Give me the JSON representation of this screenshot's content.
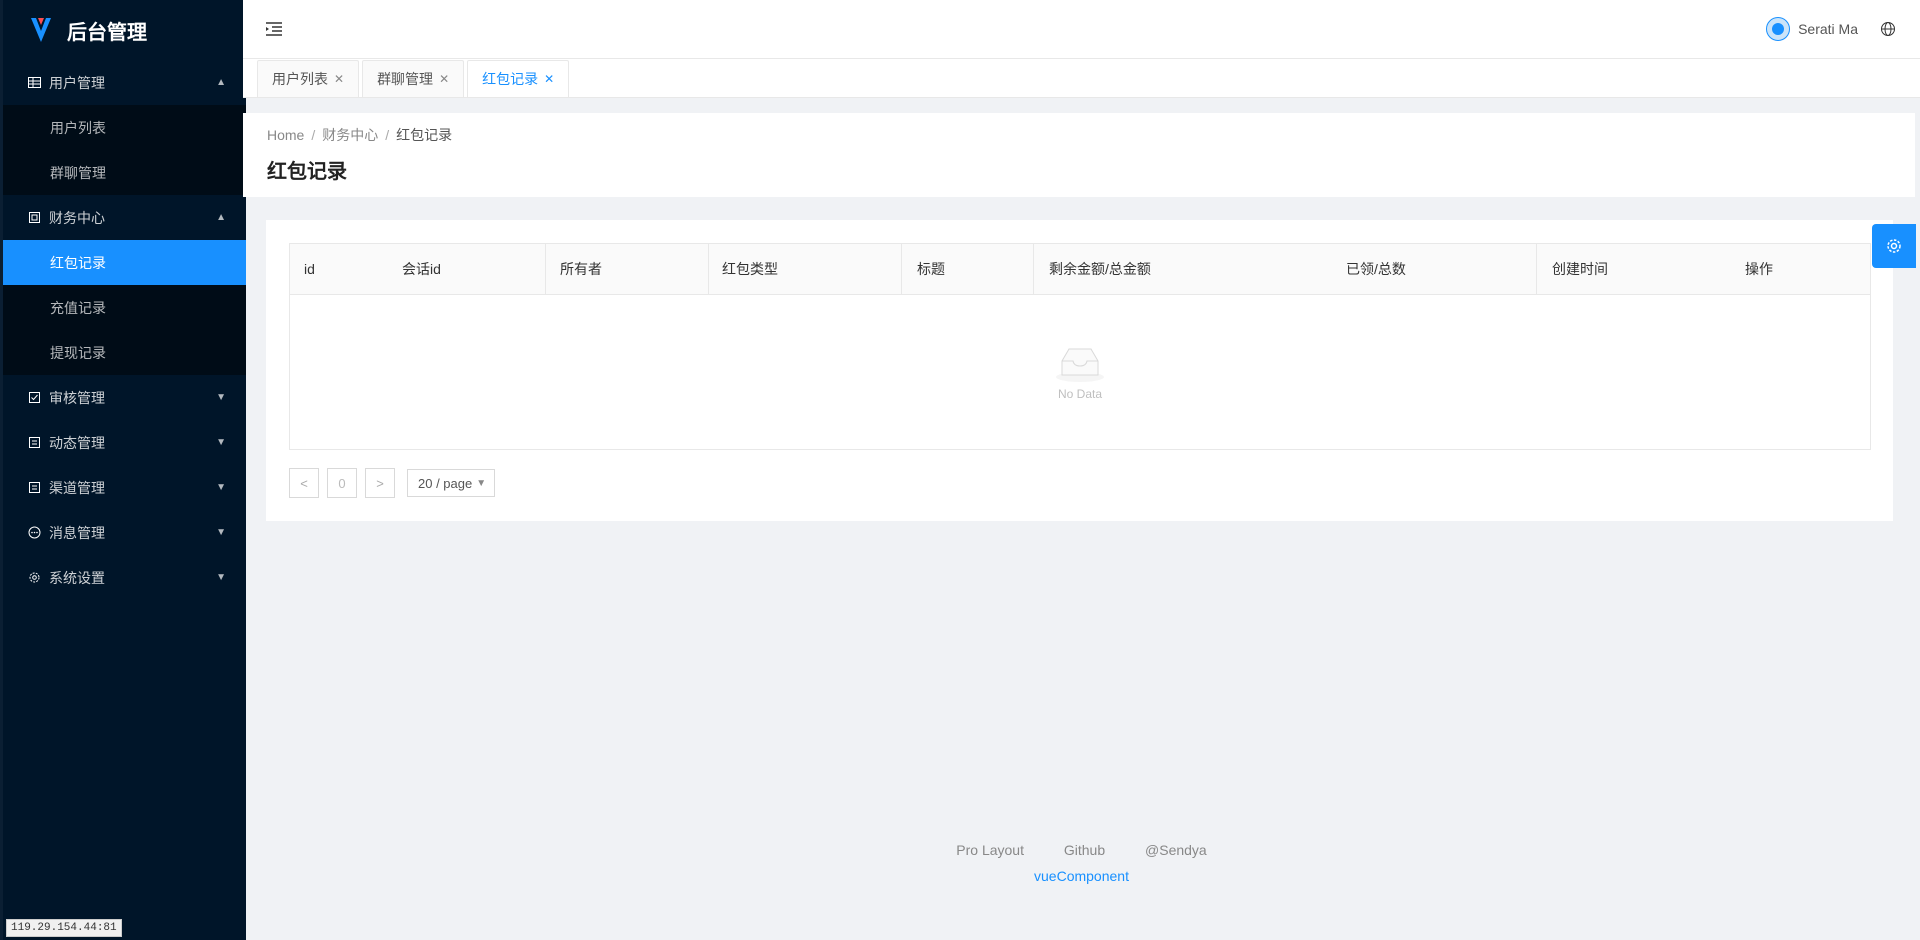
{
  "app": {
    "title": "后台管理",
    "brand_color": "#1890ff",
    "sidebar_bg": "#001529"
  },
  "sidebar": {
    "groups": [
      {
        "label": "用户管理",
        "icon": "table-icon",
        "expanded": true,
        "items": [
          {
            "label": "用户列表"
          },
          {
            "label": "群聊管理"
          }
        ]
      },
      {
        "label": "财务中心",
        "icon": "wallet-icon",
        "expanded": true,
        "items": [
          {
            "label": "红包记录",
            "active": true
          },
          {
            "label": "充值记录"
          },
          {
            "label": "提现记录"
          }
        ]
      },
      {
        "label": "审核管理",
        "icon": "check-square-icon",
        "expanded": false
      },
      {
        "label": "动态管理",
        "icon": "file-icon",
        "expanded": false
      },
      {
        "label": "渠道管理",
        "icon": "file-icon",
        "expanded": false
      },
      {
        "label": "消息管理",
        "icon": "message-icon",
        "expanded": false
      },
      {
        "label": "系统设置",
        "icon": "gear-icon",
        "expanded": false
      }
    ],
    "ip_address": "119.29.154.44:81"
  },
  "header": {
    "username": "Serati Ma"
  },
  "tabs": [
    {
      "label": "用户列表",
      "active": false
    },
    {
      "label": "群聊管理",
      "active": false
    },
    {
      "label": "红包记录",
      "active": true
    }
  ],
  "breadcrumb": [
    "Home",
    "财务中心",
    "红包记录"
  ],
  "page": {
    "title": "红包记录"
  },
  "table": {
    "columns": [
      "id",
      "会话id",
      "所有者",
      "红包类型",
      "标题",
      "剩余金额/总金额",
      "已领/总数",
      "创建时间",
      "操作"
    ],
    "rows": [],
    "empty_text": "No Data"
  },
  "pagination": {
    "current": "0",
    "page_size": "20 / page",
    "prev": "<",
    "next": ">"
  },
  "footer": {
    "links": [
      "Pro Layout",
      "Github",
      "@Sendya"
    ],
    "copyright": "vueComponent"
  }
}
